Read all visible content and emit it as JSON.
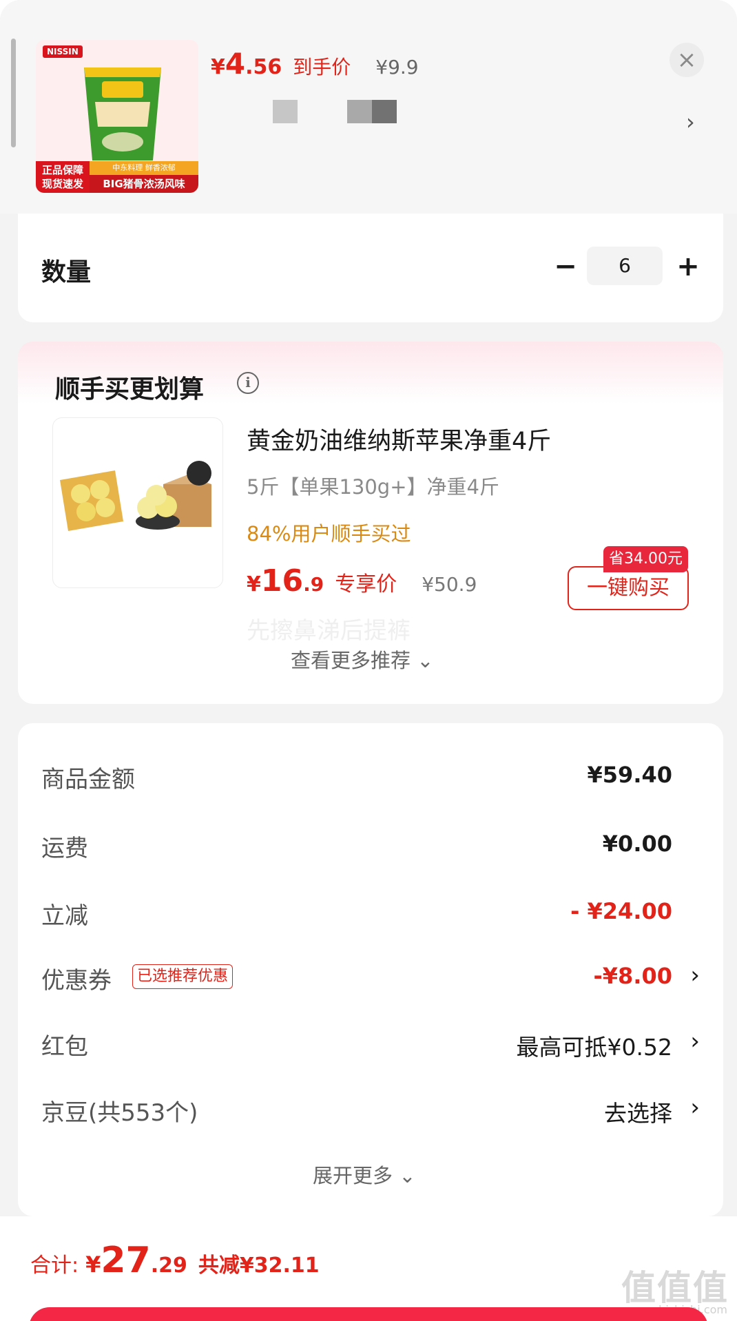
{
  "product": {
    "brand": "NISSIN",
    "thumb_tag_left": "正品保障 现货速发",
    "thumb_tag_strip": "中东料理 鲜香浓郁",
    "thumb_tag_right": "BIG猪骨浓汤风味",
    "price_currency": "¥",
    "price_int": "4",
    "price_dec": ".56",
    "price_tag": "到手价",
    "original_price": "¥9.9"
  },
  "close_icon": "close-icon",
  "quantity": {
    "label": "数量",
    "minus": "−",
    "value": "6",
    "plus": "+"
  },
  "recommend": {
    "title": "顺手买更划算",
    "info_icon": "i",
    "item": {
      "name": "黄金奶油维纳斯苹果净重4斤",
      "spec": "5斤【单果130g+】净重4斤",
      "social": "84%用户顺手买过",
      "price_currency": "¥",
      "price_int": "16",
      "price_dec": ".9",
      "price_tag": "专享价",
      "original_price": "¥50.9",
      "save_badge": "省34.00元",
      "buy_button": "一键购买"
    },
    "ghost_text": "先擦鼻涕后提裤",
    "more_label": "查看更多推荐",
    "more_chevron": "⌄"
  },
  "summary": {
    "rows": [
      {
        "label": "商品金额",
        "value": "¥59.40"
      },
      {
        "label": "运费",
        "value": "¥0.00"
      },
      {
        "label": "立减",
        "value": "- ¥24.00"
      },
      {
        "label": "优惠券",
        "badge": "已选推荐优惠",
        "value": "-¥8.00"
      },
      {
        "label": "红包",
        "value": "最高可抵¥0.52"
      },
      {
        "label": "京豆(共553个)",
        "value": "去选择"
      }
    ],
    "chevron": "›",
    "expand_label": "展开更多",
    "expand_chevron": "⌄"
  },
  "bottom": {
    "total_label": "合计:",
    "currency": "¥",
    "total_int": "27",
    "total_dec": ".29",
    "saved": "共减¥32.11",
    "watermark": "值值值",
    "watermark_url": "zhizhizhi.com"
  },
  "colors": {
    "accent_red": "#e2231a",
    "social_orange": "#d98a14",
    "submit_red": "#f42745"
  }
}
